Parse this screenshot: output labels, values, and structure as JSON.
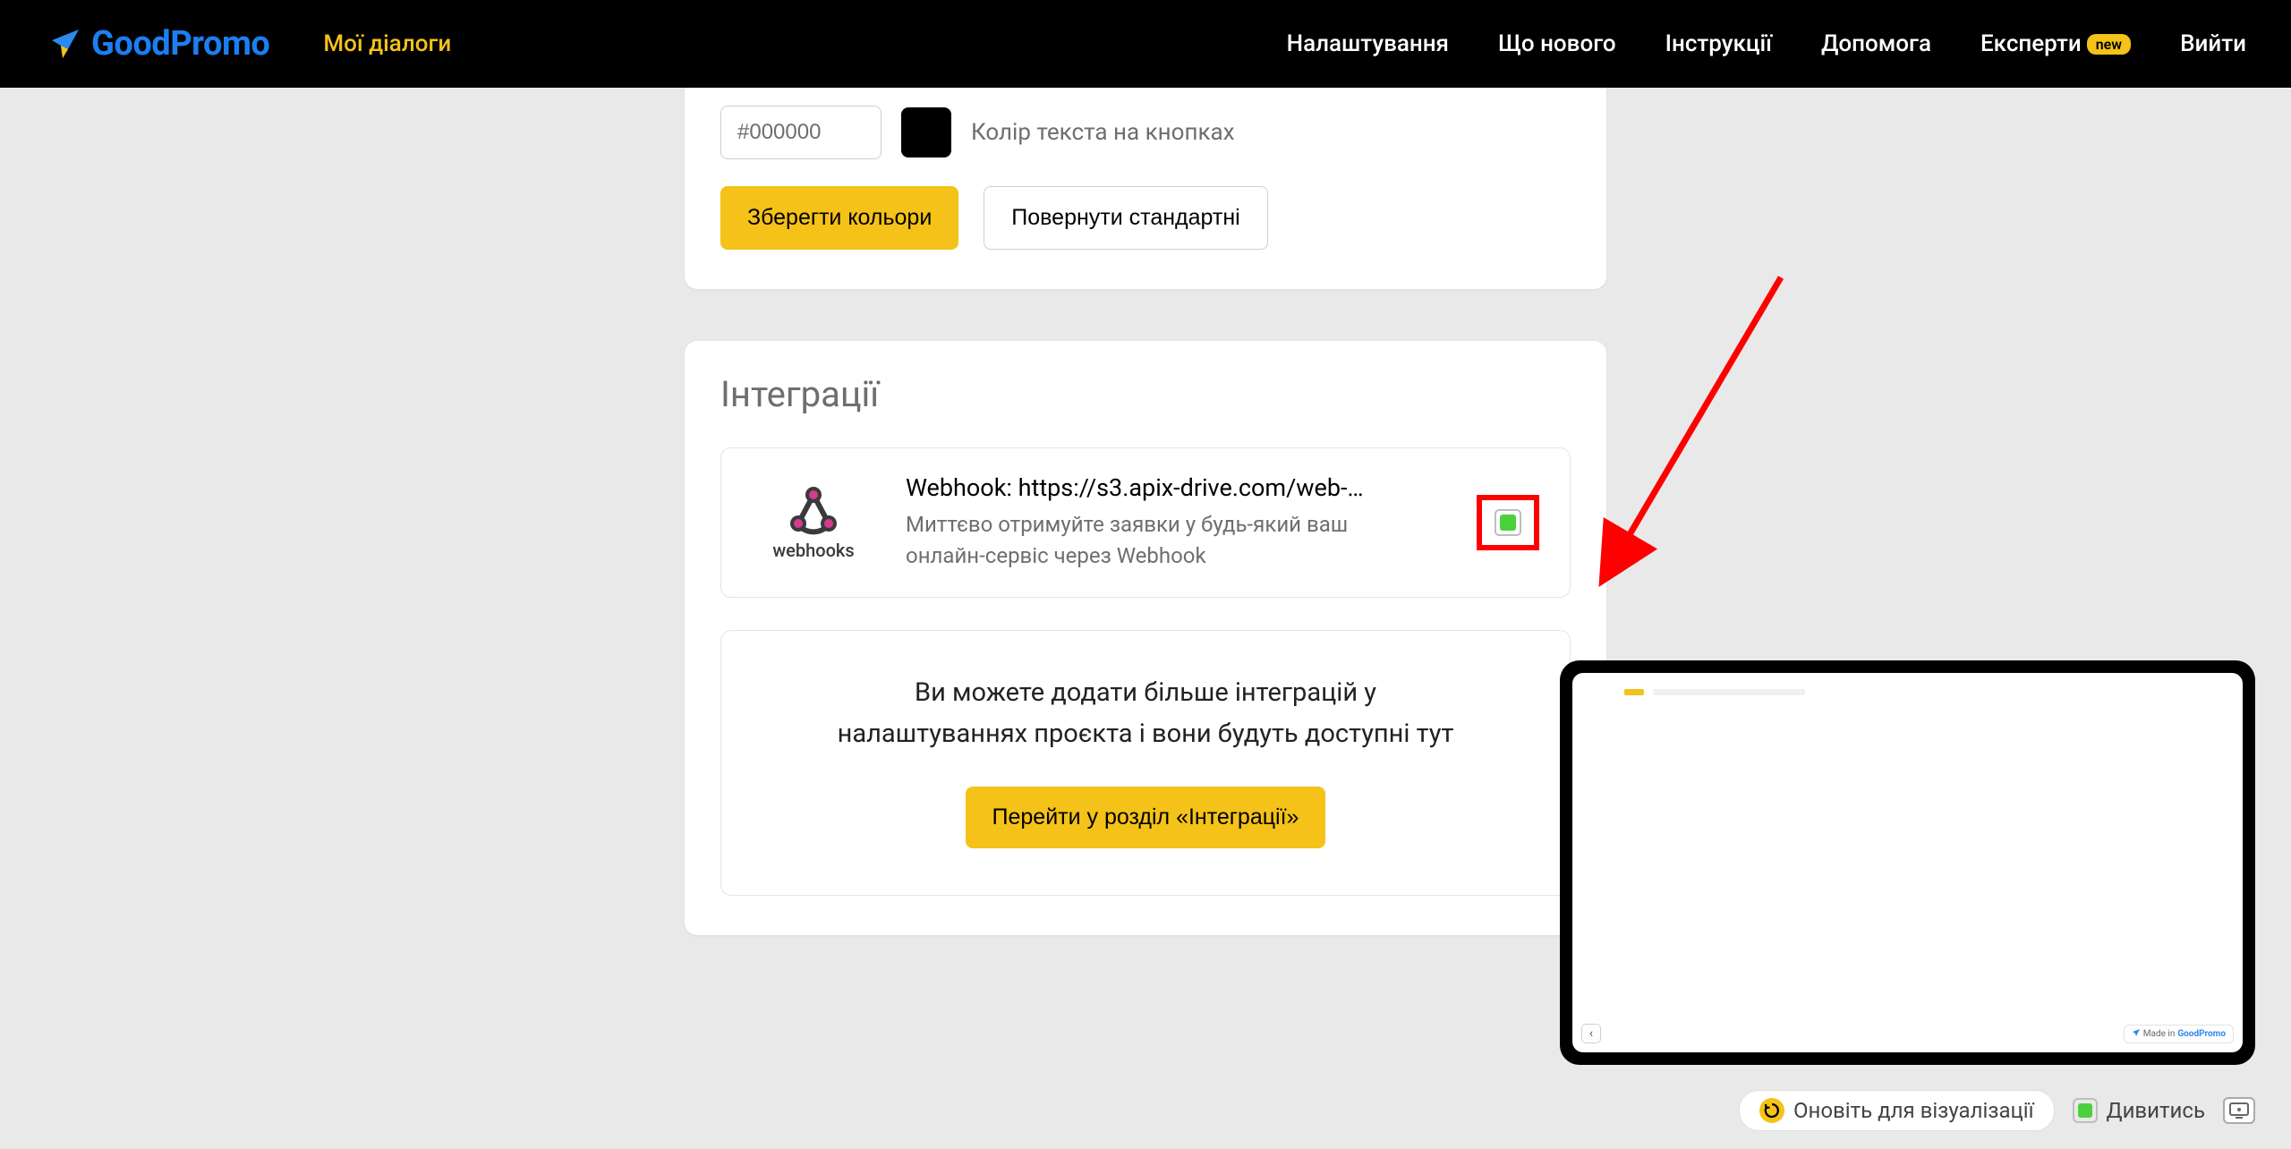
{
  "nav": {
    "logo_text": "GoodPromo",
    "my_dialogs": "Мої діалоги",
    "settings": "Налаштування",
    "whats_new": "Що нового",
    "instructions": "Інструкції",
    "help": "Допомога",
    "experts_label": "Експерти",
    "experts_badge": "new",
    "logout": "Вийти"
  },
  "colors_card": {
    "input_value": "#000000",
    "swatch_hex": "#000000",
    "label": "Колір текста на кнопках",
    "save_btn": "Зберегти кольори",
    "reset_btn": "Повернути стандартні"
  },
  "integrations": {
    "title": "Інтеграції",
    "webhook": {
      "icon_label": "webhooks",
      "title": "Webhook: https://s3.apix-drive.com/web-…",
      "desc": "Миттєво отримуйте заявки у будь-який ваш онлайн-сервіс через Webhook",
      "checked": true
    },
    "more_text_line1": "Ви можете додати більше інтеграцій у",
    "more_text_line2": "налаштуваннях проєкта і вони будуть доступні тут",
    "more_btn": "Перейти у розділ «Інтеграції»"
  },
  "preview": {
    "collapse_glyph": "‹",
    "brand_prefix": "Made in",
    "brand_name": "GoodPromo"
  },
  "bottom_bar": {
    "refresh_label": "Оновіть для візуалізації",
    "view_label": "Дивитись"
  },
  "accent_color": "#f4c218",
  "annotation_arrow_color": "#f00"
}
